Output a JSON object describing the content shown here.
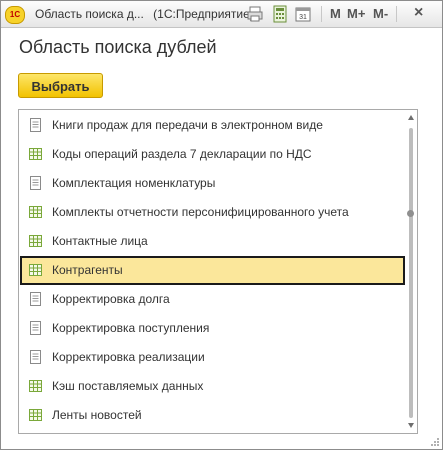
{
  "window": {
    "title": "Область поиска д...",
    "app_name": "(1С:Предприятие)",
    "logo_text": "1С",
    "memory_buttons": [
      "M",
      "M+",
      "M-"
    ],
    "close_symbol": "×"
  },
  "heading": "Область поиска дублей",
  "choose_button": "Выбрать",
  "list": {
    "items": [
      {
        "label": "Книги продаж для передачи в электронном виде",
        "icon": "document-icon",
        "selected": false
      },
      {
        "label": "Коды операций раздела 7 декларации по НДС",
        "icon": "table-icon",
        "selected": false
      },
      {
        "label": "Комплектация номенклатуры",
        "icon": "document-icon",
        "selected": false
      },
      {
        "label": "Комплекты отчетности персонифицированного учета",
        "icon": "table-icon",
        "selected": false
      },
      {
        "label": "Контактные лица",
        "icon": "table-icon",
        "selected": false
      },
      {
        "label": "Контрагенты",
        "icon": "table-icon",
        "selected": true
      },
      {
        "label": "Корректировка долга",
        "icon": "document-icon",
        "selected": false
      },
      {
        "label": "Корректировка поступления",
        "icon": "document-icon",
        "selected": false
      },
      {
        "label": "Корректировка реализации",
        "icon": "document-icon",
        "selected": false
      },
      {
        "label": "Кэш поставляемых данных",
        "icon": "table-icon",
        "selected": false
      },
      {
        "label": "Ленты новостей",
        "icon": "table-icon",
        "selected": false
      }
    ]
  },
  "colors": {
    "accent_yellow": "#f2c200",
    "selection_fill": "#fbe79b",
    "selection_border": "#1a1a1a",
    "icon_green": "#7aa83a"
  }
}
